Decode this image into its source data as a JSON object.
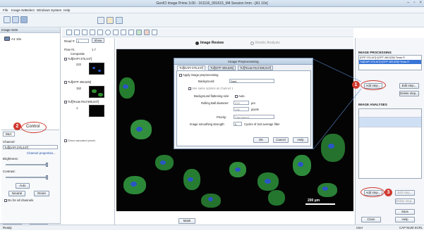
{
  "window": {
    "title": "GenIO Image Prime 3.00 - 161116_091615_M4 Session Imm - [A1 10x]",
    "controls": [
      "–",
      "▫",
      "×"
    ]
  },
  "menu": {
    "items": [
      "File",
      "Image Set",
      "Select",
      "Windows",
      "System",
      "Help"
    ]
  },
  "left": {
    "title": "Image Sets",
    "tree_item": "A1 10x",
    "control_tab": "B&C",
    "channel_label": "Channel:",
    "channel_value": "Tuf[DAPI 375,447]",
    "channel_props": "Channel properties...",
    "brightness_label": "Brightness:",
    "contrast_label": "Contrast:",
    "auto_btn": "Auto",
    "neutral_btn": "Neutral",
    "reset_btn": "Reset",
    "all_channels": "Do for all channels",
    "tabs": [
      "Image Sets",
      "Instrument"
    ]
  },
  "callouts": {
    "control": "Control",
    "n1": "1",
    "n2": "2",
    "n3": "3"
  },
  "mid": {
    "read_label": "Read #:",
    "read_value": "1",
    "show_btn": "Show",
    "header_a": "Flow #1",
    "header_b": "1.7",
    "composite": "Composite",
    "items": [
      {
        "label": "Tuf[DAPI 375,447]",
        "value": "222"
      },
      {
        "label": "Tuf[GFP 469,525]",
        "value": "152"
      },
      {
        "label": "Tuf[Texas Red 586,647]",
        "value": "1"
      }
    ],
    "show_saturated": "Show saturated pixels"
  },
  "view": {
    "tab_review": "Image Review",
    "tab_kinetic": "Kinetic Analysis",
    "scale_label": "200 µm",
    "mask_btn": "Mask"
  },
  "dialog": {
    "title": "Image Preprocessing",
    "tabs": [
      "Tuf[DAPI 375,447]",
      "Tuf[GFP 469,525]",
      "Tuf[Texas Red 586,647]"
    ],
    "apply_label": "Apply image preprocessing",
    "background_label": "Background:",
    "background_value": "Dark",
    "same_options": "Use same options as channel 1",
    "flatten_label": "Background flattening size:",
    "auto_label": "Auto",
    "rolling_label": "Rolling Ball diameter:",
    "rolling_value": "219",
    "rolling_unit": "µm",
    "pixels_value": "136",
    "pixels_unit": "pixels",
    "priority_label": "Priority:",
    "priority_value": "Fast speed",
    "smooth_label": "Image smoothing strength:",
    "smooth_value": "0",
    "smooth_unit": "Cycles of 3x3 average filter",
    "ok": "OK",
    "cancel": "Cancel",
    "help": "Help"
  },
  "right": {
    "processing_title": "IMAGE PROCESSING",
    "proc_items": [
      "[GFP 375,447]+[GFP 469,525]+Texas R",
      "Tuf[DAPI 375,447]+[GFP 469,525]+Texas R"
    ],
    "add_step": "Add step...",
    "edit_step": "Edit step...",
    "delete_step": "Delete step...",
    "analyses_title": "IMAGE ANALYSES",
    "add_step2": "Add step...",
    "edit_step2": "Edit step...",
    "delete_step2": "Delete step...",
    "save": "Save",
    "close": "Close",
    "help": "Help"
  },
  "status": {
    "left": "Ready",
    "user": "User",
    "right": "CAP NUM SCRL"
  }
}
